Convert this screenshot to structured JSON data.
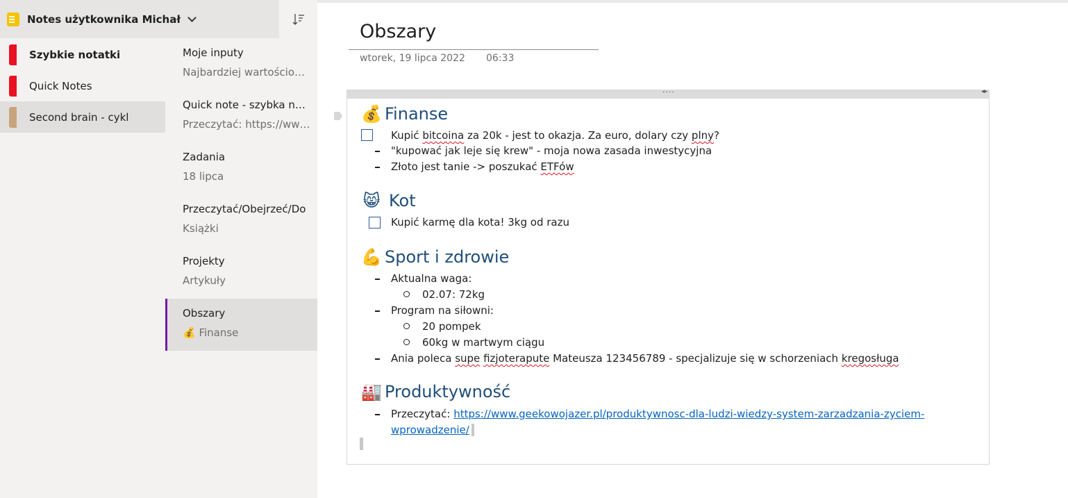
{
  "notebook": {
    "title": "Notes użytkownika Michał"
  },
  "sections": [
    {
      "label": "Szybkie notatki",
      "color": "#e81123",
      "selected": false,
      "bold": true
    },
    {
      "label": "Quick Notes",
      "color": "#e81123",
      "selected": false,
      "bold": false
    },
    {
      "label": "Second brain - cykl",
      "color": "#c8a47c",
      "selected": true,
      "bold": false
    }
  ],
  "pages": [
    {
      "title": "Moje inputy",
      "subtitle": "Najbardziej wartościowe:"
    },
    {
      "title": "Quick note - szybka notatka",
      "subtitle": "Przeczytać: https://www.geekowojazer.pl"
    },
    {
      "title": "Zadania",
      "subtitle": "18 lipca"
    },
    {
      "title": "Przeczytać/Obejrzeć/Do",
      "subtitle": "Książki"
    },
    {
      "title": "Projekty",
      "subtitle": "Artykuły"
    },
    {
      "title": "Obszary",
      "subtitle": "💰 Finanse",
      "selected": true
    }
  ],
  "page": {
    "title": "Obszary",
    "date": "wtorek, 19 lipca 2022",
    "time": "06:33"
  },
  "note": {
    "finanse": {
      "heading": "Finanse",
      "todo": [
        "Kupić ",
        "bitcoina",
        " za 20k - jest to okazja. Za euro, dolary czy ",
        "plny",
        "?"
      ],
      "bullet1": "\"kupować jak leje się krew\" - moja nowa zasada inwestycyjna",
      "bullet2_a": "Złoto jest tanie -> poszukać ",
      "bullet2_b": "ETFów"
    },
    "kot": {
      "heading": "Kot",
      "todo": "Kupić karmę dla kota! 3kg od razu"
    },
    "sport": {
      "heading": "Sport i zdrowie",
      "b1": "Aktualna waga:",
      "b1_1": "02.07: 72kg",
      "b2": "Program na siłowni:",
      "b2_1": "20 pompek",
      "b2_2": "60kg w martwym ciągu",
      "b3_a": "Ania poleca ",
      "b3_b": "supe",
      "b3_c": " ",
      "b3_d": "fizjoterapute",
      "b3_e": " Mateusza 123456789 - specjalizuje się w schorzeniach ",
      "b3_f": "kregosługa"
    },
    "produktywnosc": {
      "heading": "Produktywność",
      "prefix": "Przeczytać: ",
      "link_line1": "https://www.geekowojazer.pl/produktywnosc-dla-ludzi-wiedzy-system-zarzadzania-zyciem-",
      "link_line2": "wprowadzenie/"
    }
  },
  "icons": {
    "notebook": "notebook-icon",
    "chevron": "chevron-down-icon",
    "sort": "sort-icon",
    "money_bag": "💰",
    "cat": "😸",
    "muscle": "💪",
    "factory": "🏭"
  }
}
